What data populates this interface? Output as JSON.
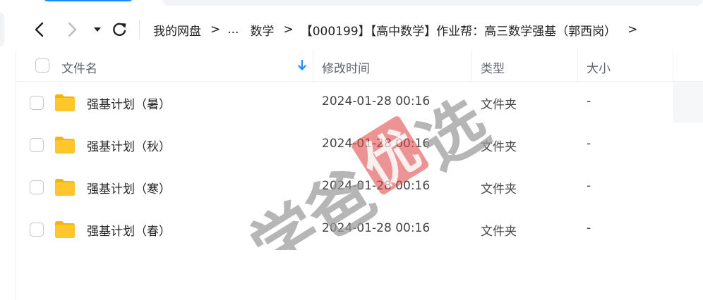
{
  "nav": {
    "back_icon": "chevron-left-icon",
    "forward_icon": "chevron-right-icon",
    "history_icon": "caret-down-icon",
    "refresh_icon": "refresh-icon"
  },
  "breadcrumb": {
    "items": [
      "我的网盘",
      "...",
      "数学",
      "【000199】【高中数学】作业帮：高三数学强基（郭西岗）"
    ],
    "separator": ">"
  },
  "table": {
    "headers": {
      "name": "文件名",
      "modified": "修改时间",
      "type": "类型",
      "size": "大小"
    },
    "sort_icon": "arrow-down-icon",
    "rows": [
      {
        "name": "强基计划（暑）",
        "modified": "2024-01-28 00:16",
        "type": "文件夹",
        "size": "-"
      },
      {
        "name": "强基计划（秋）",
        "modified": "2024-01-28 00:16",
        "type": "文件夹",
        "size": "-"
      },
      {
        "name": "强基计划（寒）",
        "modified": "2024-01-28 00:16",
        "type": "文件夹",
        "size": "-"
      },
      {
        "name": "强基计划（春）",
        "modified": "2024-01-28 00:16",
        "type": "文件夹",
        "size": "-"
      }
    ]
  },
  "watermark": {
    "text_left": "学爸",
    "text_seal": "优",
    "text_right": "选"
  },
  "colors": {
    "accent": "#1a8cff",
    "folder": "#ffc72c",
    "folder_back": "#f5b400",
    "watermark_gray": "#9a9a9a",
    "watermark_red": "#e04646"
  }
}
